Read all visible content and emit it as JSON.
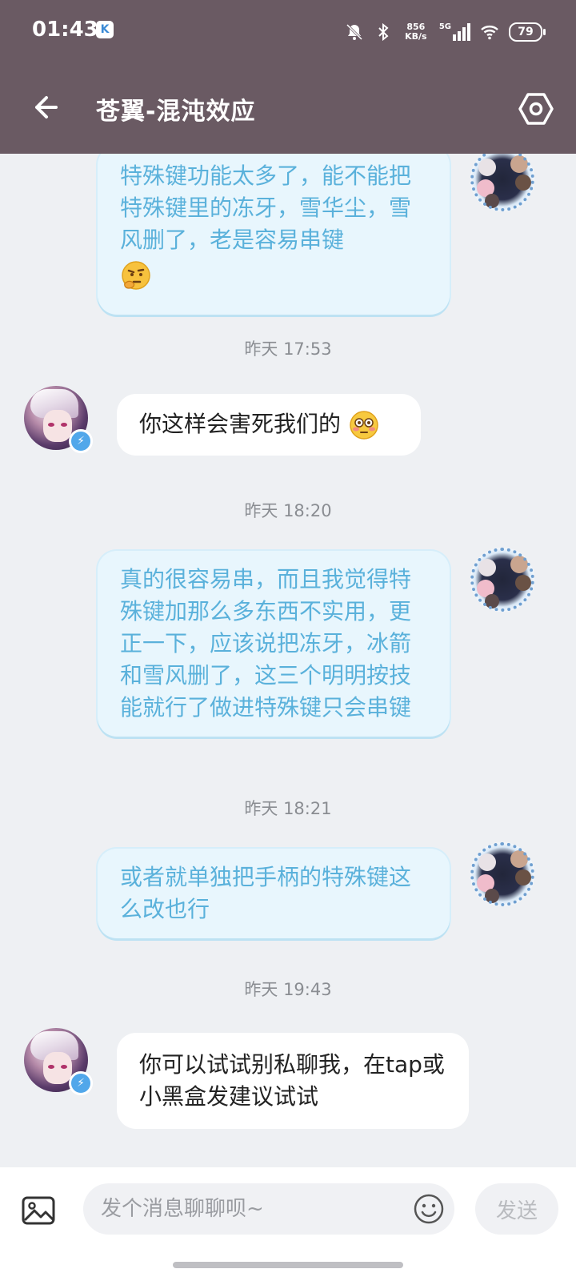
{
  "status_bar": {
    "time": "01:43",
    "app_badge": "K",
    "net_speed_value": "856",
    "net_speed_unit": "KB/s",
    "network": "5G",
    "battery": "79"
  },
  "header": {
    "title": "苍翼-混沌效应"
  },
  "messages": [
    {
      "side": "self",
      "text": "特殊键功能太多了，能不能把特殊键里的冻牙，雪华尘，雪风删了，老是容易串键",
      "emoji": "thinking-face"
    },
    {
      "type": "timestamp",
      "text": "昨天 17:53"
    },
    {
      "side": "other",
      "text": "你这样会害死我们的",
      "emoji": "flushed-face"
    },
    {
      "type": "timestamp",
      "text": "昨天 18:20"
    },
    {
      "side": "self",
      "text": "真的很容易串，而且我觉得特殊键加那么多东西不实用，更正一下，应该说把冻牙，冰箭和雪风删了，这三个明明按技能就行了做进特殊键只会串键"
    },
    {
      "type": "timestamp",
      "text": "昨天 18:21"
    },
    {
      "side": "self",
      "text": "或者就单独把手柄的特殊键这么改也行"
    },
    {
      "type": "timestamp",
      "text": "昨天 19:43"
    },
    {
      "side": "other",
      "text": "你可以试试别私聊我，在tap或小黑盒发建议试试"
    }
  ],
  "input": {
    "placeholder": "发个消息聊聊呗~",
    "send_label": "发送"
  },
  "colors": {
    "header_bg": "#6a5a63",
    "self_bubble_bg": "#e8f6fd",
    "self_text": "#5ab1db",
    "other_bubble_bg": "#ffffff",
    "page_bg": "#eef0f3"
  }
}
